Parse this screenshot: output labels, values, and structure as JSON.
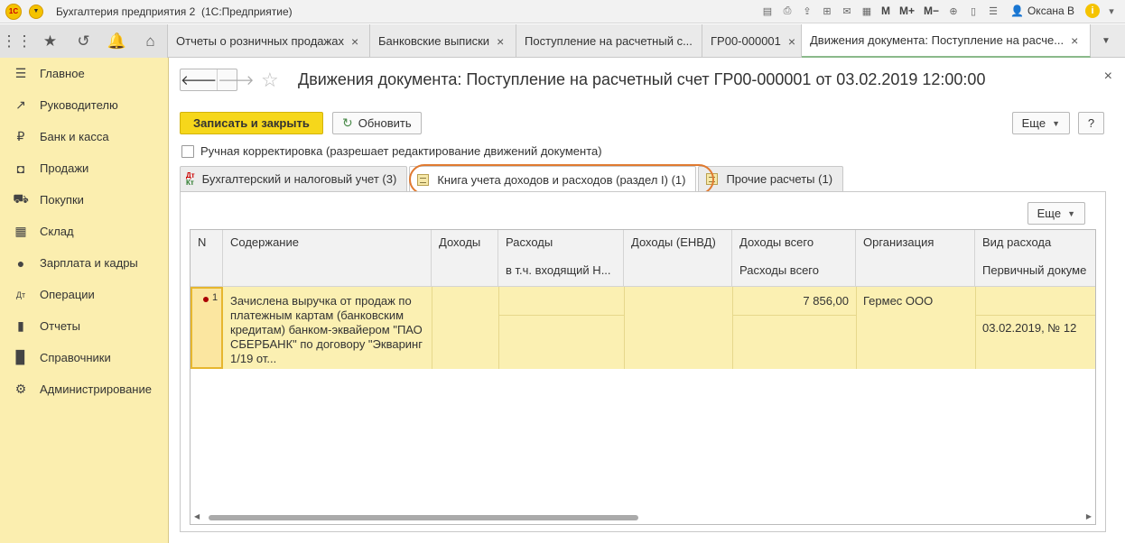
{
  "titlebar": {
    "logo": "1С",
    "app_title": "Бухгалтерия предприятия 2",
    "app_subtitle": "(1С:Предприятие)",
    "m_buttons": [
      "M",
      "M+",
      "M−"
    ],
    "user": "Оксана В"
  },
  "open_tabs": [
    {
      "label": "Отчеты о розничных продажах",
      "close": "×"
    },
    {
      "label": "Банковские выписки",
      "close": "×"
    },
    {
      "label": "Поступление на расчетный с...",
      "close": ""
    },
    {
      "label": "ГР00-000001",
      "close": "×"
    },
    {
      "label": "Движения документа: Поступление на расче...",
      "close": "×"
    }
  ],
  "sidebar": {
    "items": [
      {
        "label": "Главное",
        "icon": "menu-icon"
      },
      {
        "label": "Руководителю",
        "icon": "trend-icon"
      },
      {
        "label": "Банк и касса",
        "icon": "ruble-icon"
      },
      {
        "label": "Продажи",
        "icon": "bag-icon"
      },
      {
        "label": "Покупки",
        "icon": "cart-icon"
      },
      {
        "label": "Склад",
        "icon": "grid-icon"
      },
      {
        "label": "Зарплата и кадры",
        "icon": "person-icon"
      },
      {
        "label": "Операции",
        "icon": "dtkt-icon"
      },
      {
        "label": "Отчеты",
        "icon": "barchart-icon"
      },
      {
        "label": "Справочники",
        "icon": "book-icon"
      },
      {
        "label": "Администрирование",
        "icon": "gear-icon"
      }
    ]
  },
  "form": {
    "title": "Движения документа: Поступление на расчетный счет ГР00-000001 от 03.02.2019 12:00:00",
    "save_close": "Записать и закрыть",
    "refresh": "Обновить",
    "more": "Еще",
    "help": "?",
    "manual_correction": "Ручная корректировка (разрешает редактирование движений документа)",
    "tabs": [
      "Бухгалтерский и налоговый учет (3)",
      "Книга учета доходов и расходов (раздел I) (1)",
      "Прочие расчеты (1)"
    ],
    "panel_more": "Еще"
  },
  "table": {
    "headers": {
      "n": "N",
      "content": "Содержание",
      "income": "Доходы",
      "expenses": "Расходы",
      "expenses_sub": "в т.ч. входящий Н...",
      "income_envd": "Доходы (ЕНВД)",
      "income_total": "Доходы всего",
      "expenses_total": "Расходы всего",
      "org": "Организация",
      "expense_type": "Вид расхода",
      "primary_doc": "Первичный докуме"
    },
    "rows": [
      {
        "n": "1",
        "content": "Зачислена выручка от продаж по платежным картам (банковским кредитам) банком-эквайером \"ПАО СБЕРБАНК\" по договору \"Экваринг 1/19 от...",
        "income_total": "7 856,00",
        "org": "Гермес ООО",
        "primary_doc": "03.02.2019, № 12"
      }
    ]
  }
}
